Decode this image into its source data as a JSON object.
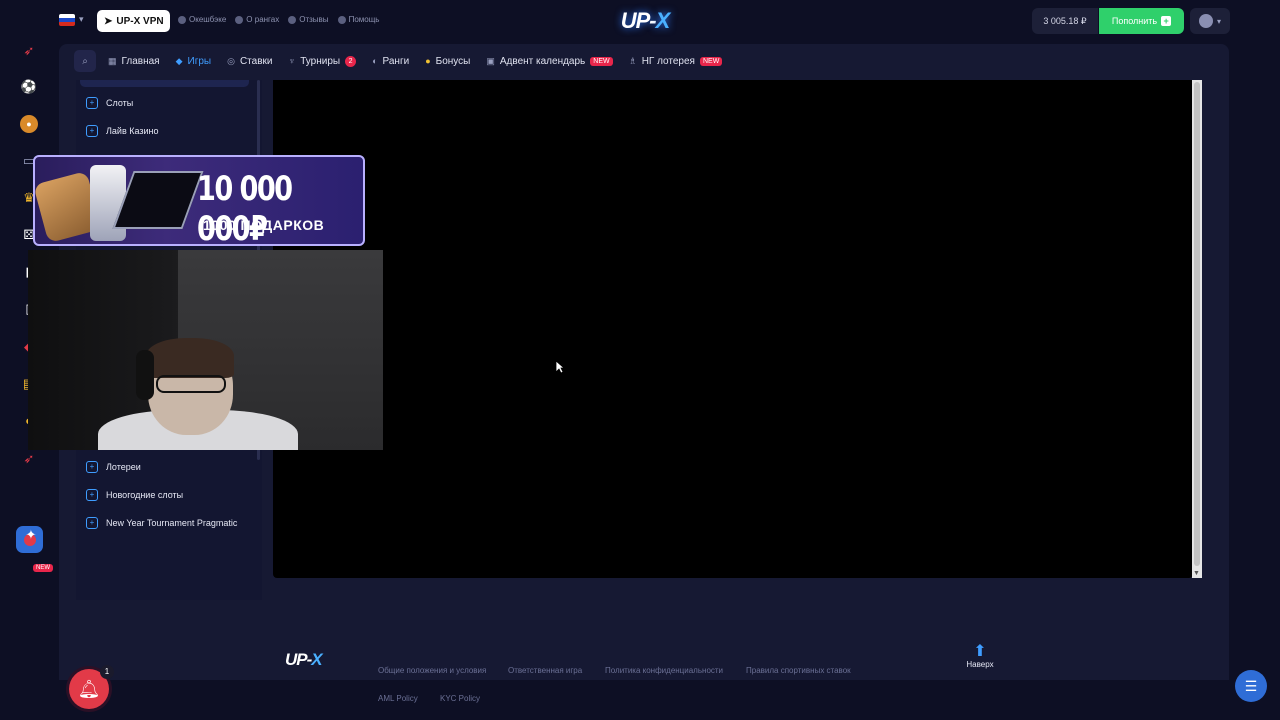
{
  "header": {
    "vpn_label": "UP-X VPN",
    "links": [
      {
        "label": "Окешбэке",
        "icon": "cashback-icon"
      },
      {
        "label": "О рангах",
        "icon": "ranks-icon"
      },
      {
        "label": "Отзывы",
        "icon": "reviews-icon"
      },
      {
        "label": "Помощь",
        "icon": "help-icon"
      }
    ],
    "logo": "UP-",
    "logo_x": "X",
    "balance": "3 005.18 ₽",
    "deposit_label": "Пополнить"
  },
  "nav": {
    "items": [
      {
        "label": "Главная",
        "icon": "grid-icon"
      },
      {
        "label": "Игры",
        "icon": "drop-icon",
        "active": true
      },
      {
        "label": "Ставки",
        "icon": "ball-icon"
      },
      {
        "label": "Турниры",
        "icon": "trophy-icon",
        "badge": "2"
      },
      {
        "label": "Ранги",
        "icon": "medal-icon"
      },
      {
        "label": "Бонусы",
        "icon": "coin-icon"
      },
      {
        "label": "Адвент календарь",
        "icon": "calendar-icon",
        "tag": "NEW"
      },
      {
        "label": "НГ лотерея",
        "icon": "lottery-icon",
        "tag": "NEW"
      }
    ]
  },
  "categories": {
    "top": [
      {
        "label": "Слоты"
      },
      {
        "label": "Лайв Казино"
      }
    ],
    "bottom": [
      {
        "label": "Лотереи"
      },
      {
        "label": "Новогодние слоты"
      },
      {
        "label": "New Year Tournament Pragmatic"
      }
    ]
  },
  "promo": {
    "title": "10 000 000₽",
    "subtitle": "1000 ПОДАРКОВ"
  },
  "rail": {
    "new_tag": "NEW"
  },
  "footer": {
    "logo": "UP-",
    "logo_x": "X",
    "links": [
      "Общие положения и условия",
      "Ответственная игра",
      "Политика конфиденциальности",
      "Правила спортивных ставок"
    ],
    "links2": [
      "AML Policy",
      "KYC Policy"
    ],
    "up_label": "Наверх",
    "notif_count": "1"
  }
}
